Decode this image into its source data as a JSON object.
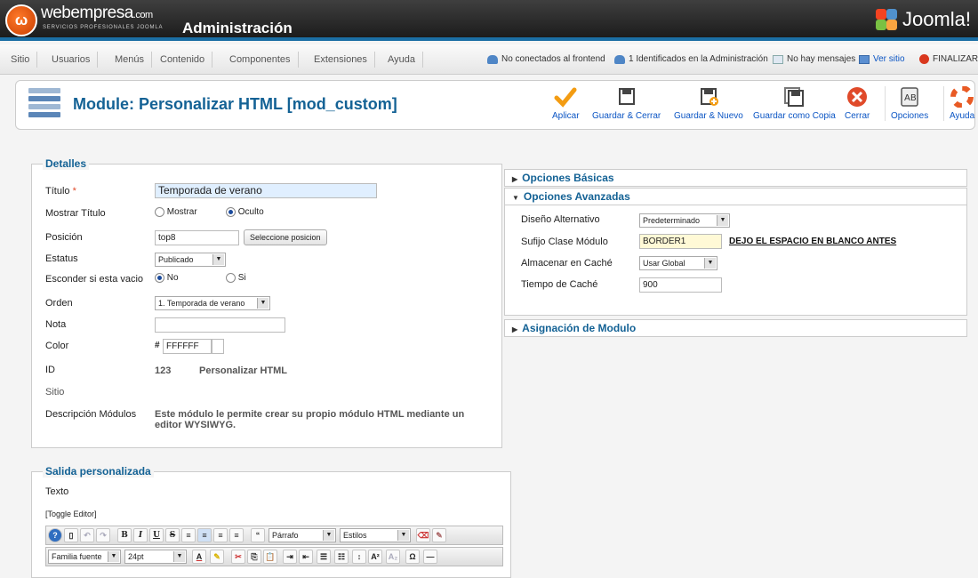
{
  "header": {
    "brand": "webempresa",
    "brand_suffix": ".com",
    "brand_sub": "SERVICIOS PROFESIONALES JOOMLA",
    "title": "Administración",
    "joomla": "Joomla!"
  },
  "menu": {
    "items": [
      "Sitio",
      "Usuarios",
      "Menús",
      "Contenido",
      "Componentes",
      "Extensiones",
      "Ayuda"
    ],
    "status": {
      "frontend": "No conectados al frontend",
      "admin": "1 Identificados en la Administración",
      "messages": "No hay mensajes",
      "view_site": "Ver sitio",
      "logout": "FINALIZAR"
    }
  },
  "toolbar": {
    "title": "Module: Personalizar HTML [mod_custom]",
    "buttons": {
      "apply": "Aplicar",
      "save_close": "Guardar & Cerrar",
      "save_new": "Guardar & Nuevo",
      "save_copy": "Guardar como Copia",
      "close": "Cerrar",
      "options": "Opciones",
      "help": "Ayuda"
    }
  },
  "detalles": {
    "legend": "Detalles",
    "title_label": "Título",
    "required_mark": "*",
    "title_value": "Temporada de verano",
    "show_title_label": "Mostrar Título",
    "show_option": "Mostrar",
    "hide_option": "Oculto",
    "show_title_selected": "Oculto",
    "position_label": "Posición",
    "position_value": "top8",
    "position_button": "Seleccione posicion",
    "status_label": "Estatus",
    "status_value": "Publicado",
    "hide_empty_label": "Esconder si esta vacio",
    "no_option": "No",
    "yes_option": "Si",
    "hide_empty_selected": "No",
    "order_label": "Orden",
    "order_value": "1. Temporada de verano",
    "note_label": "Nota",
    "note_value": "",
    "color_label": "Color",
    "color_hash": "#",
    "color_value": "FFFFFF",
    "id_label": "ID",
    "id_value": "123",
    "id_module_name": "Personalizar HTML",
    "site_label": "Sitio",
    "desc_label": "Descripción Módulos",
    "desc_value": "Este módulo le permite crear su propio módulo HTML mediante un editor WYSIWYG."
  },
  "salida": {
    "legend": "Salida personalizada",
    "text_label": "Texto",
    "toggle_editor": "[Toggle Editor]",
    "format_value": "Párrafo",
    "styles_value": "Estilos",
    "font_family_value": "Familia fuente",
    "font_size_value": "24pt"
  },
  "panels": {
    "basic": "Opciones Básicas",
    "advanced": "Opciones Avanzadas",
    "assignment": "Asignación de Modulo",
    "alt_layout_label": "Diseño Alternativo",
    "alt_layout_value": "Predeterminado",
    "class_suffix_label": "Sufijo Clase Módulo",
    "class_suffix_value": "BORDER1",
    "class_suffix_note": "DEJO EL ESPACIO EN BLANCO ANTES",
    "cache_label": "Almacenar en Caché",
    "cache_value": "Usar Global",
    "cache_time_label": "Tiempo de Caché",
    "cache_time_value": "900"
  },
  "colors": {
    "accent_blue": "#146295",
    "link_blue": "#0b55c4",
    "header_dark": "#2a2a2a",
    "apply_orange": "#f39c12",
    "close_red": "#e04a2a",
    "highlight_yellow": "#fff9d6",
    "title_input_bg": "#e0efff"
  }
}
